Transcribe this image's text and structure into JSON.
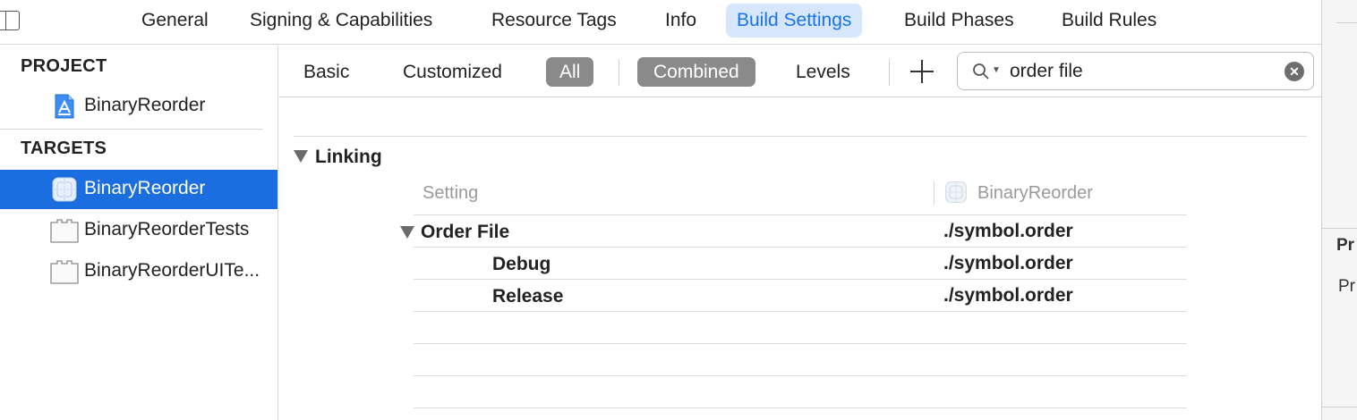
{
  "tabs": [
    {
      "label": "General"
    },
    {
      "label": "Signing & Capabilities"
    },
    {
      "label": "Resource Tags"
    },
    {
      "label": "Info"
    },
    {
      "label": "Build Settings"
    },
    {
      "label": "Build Phases"
    },
    {
      "label": "Build Rules"
    }
  ],
  "active_tab": "Build Settings",
  "sidebar": {
    "project_header": "PROJECT",
    "project": {
      "label": "BinaryReorder",
      "icon": "xcode-project-icon"
    },
    "targets_header": "TARGETS",
    "targets": [
      {
        "label": "BinaryReorder",
        "icon": "app-target-icon",
        "selected": true
      },
      {
        "label": "BinaryReorderTests",
        "icon": "test-bundle-icon",
        "selected": false
      },
      {
        "label": "BinaryReorderUITe...",
        "icon": "test-bundle-icon",
        "selected": false
      }
    ]
  },
  "filters": {
    "basic": "Basic",
    "customized": "Customized",
    "all": "All",
    "combined": "Combined",
    "levels": "Levels"
  },
  "search": {
    "value": "order file"
  },
  "settings": {
    "section_title": "Linking",
    "column_setting": "Setting",
    "column_target": "BinaryReorder",
    "rows": [
      {
        "name": "Order File",
        "value": "./symbol.order"
      },
      {
        "name": "Debug",
        "value": "./symbol.order"
      },
      {
        "name": "Release",
        "value": "./symbol.order"
      }
    ]
  },
  "inspector": {
    "text1": "Pr",
    "text2": "Pr"
  },
  "colors": {
    "accent": "#1a73e8",
    "selection": "#1a6ee0",
    "pill": "#8a8a8a"
  }
}
